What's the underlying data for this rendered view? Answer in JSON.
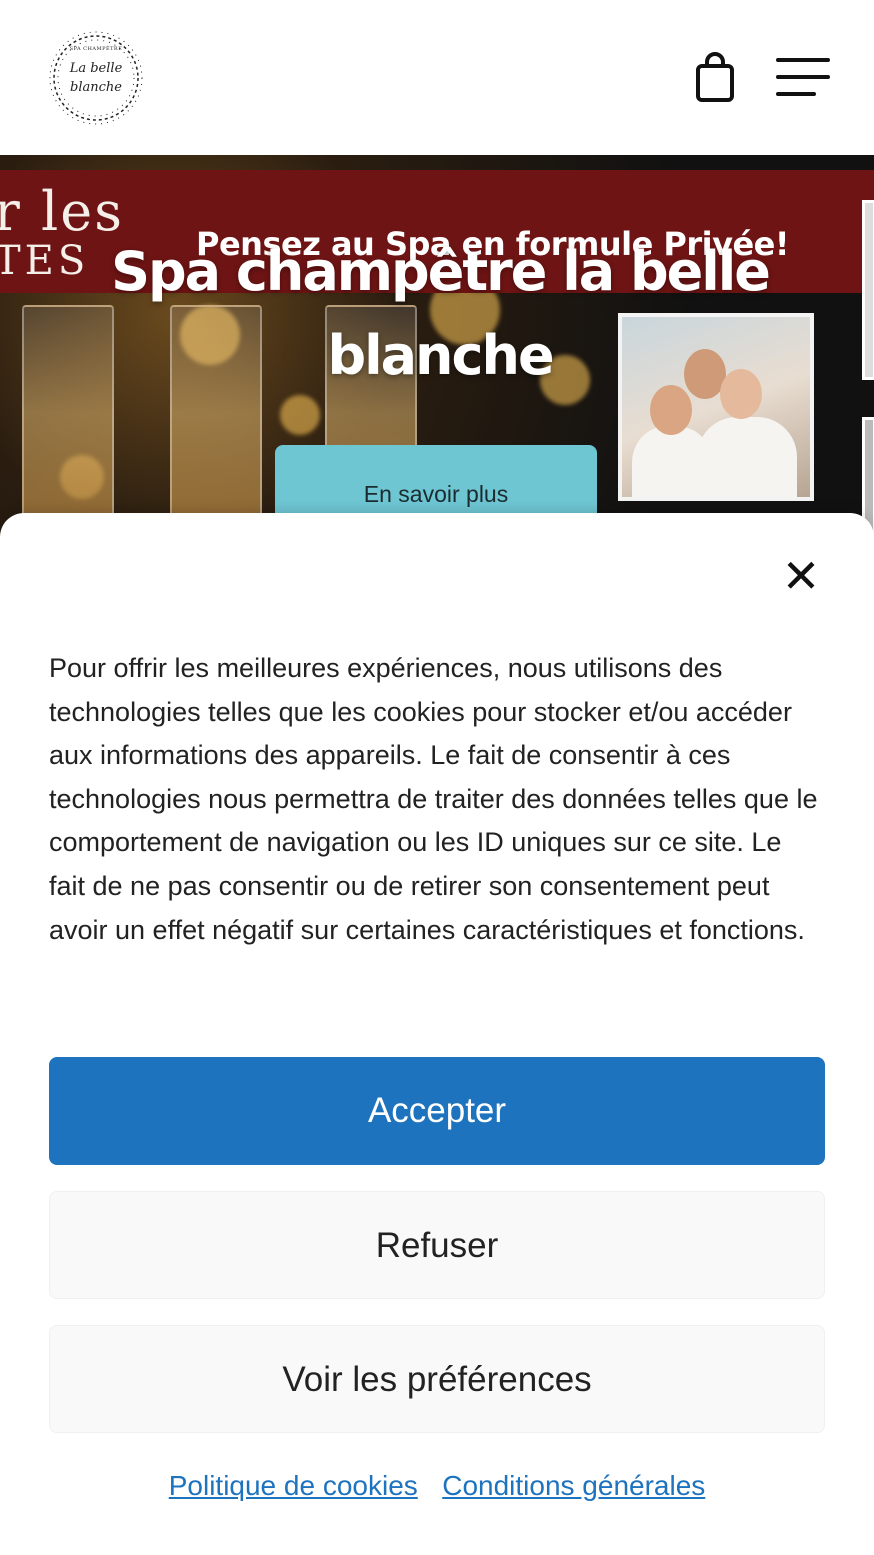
{
  "header": {
    "logo": {
      "top_text": "SPA CHAMPÊTRE",
      "line1": "La belle",
      "line2": "blanche"
    },
    "cart_icon": "shopping-bag-icon",
    "menu_icon": "hamburger-menu-icon"
  },
  "hero": {
    "strip_text_line1": "r les",
    "strip_text_line2": "TES",
    "promo": "Pensez au Spa en formule Privée!",
    "title": "Spa champêtre la belle blanche",
    "cta_label": "En savoir plus"
  },
  "cookie_modal": {
    "close_icon": "close-icon",
    "text": "Pour offrir les meilleures expériences, nous utilisons des technologies telles que les cookies pour stocker et/ou accéder aux informations des appareils. Le fait de consentir à ces technologies nous permettra de traiter des données telles que le comportement de navigation ou les ID uniques sur ce site. Le fait de ne pas consentir ou de retirer son consentement peut avoir un effet négatif sur certaines caractéristiques et fonctions.",
    "accept_label": "Accepter",
    "refuse_label": "Refuser",
    "preferences_label": "Voir les préférences",
    "cookie_policy_link": "Politique de cookies",
    "terms_link": "Conditions générales"
  },
  "colors": {
    "accent_blue": "#1e73be",
    "cta_teal": "#6ec6d3",
    "banner_red": "#6e1414"
  }
}
